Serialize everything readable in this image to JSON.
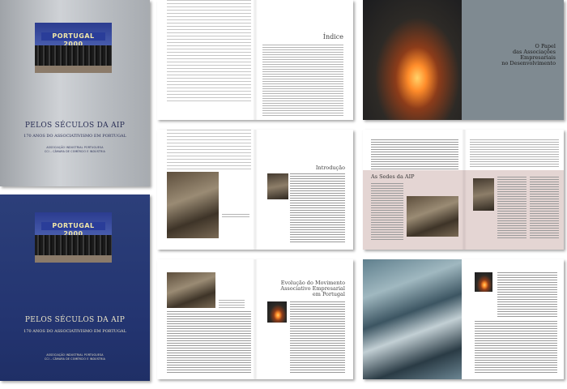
{
  "covers": [
    {
      "banner_text": "PORTUGAL 2000",
      "title": "PELOS SÉCULOS DA AIP",
      "subtitle": "170 ANOS DO ASSOCIATIVISMO EM PORTUGAL",
      "assoc_line1": "ASSOCIAÇÃO INDUSTRIAL PORTUGUESA",
      "assoc_line2": "CCI – CÂMARA DE COMÉRCIO E INDÚSTRIA",
      "background_color": "#b8bcc1",
      "text_color": "#2a2f55"
    },
    {
      "banner_text": "PORTUGAL 2000",
      "title": "PELOS SÉCULOS DA AIP",
      "subtitle": "170 ANOS DO ASSOCIATIVISMO EM PORTUGAL",
      "assoc_line1": "ASSOCIAÇÃO INDUSTRIAL PORTUGUESA",
      "assoc_line2": "CCI – CÂMARA DE COMÉRCIO E INDÚSTRIA",
      "background_color": "#233470",
      "text_color": "#e9e3c7"
    }
  ],
  "spreads": {
    "index_title": "Índice",
    "papel_title_l1": "O Papel",
    "papel_title_l2": "das Associações",
    "papel_title_l3": "Empresariais",
    "papel_title_l4": "no Desenvolvimento",
    "introducao_title": "Introdução",
    "sedes_title": "As Sedes da AIP",
    "evolucao_l1": "Evolução do Movimento",
    "evolucao_l2": "Associativo Empresarial",
    "evolucao_l3": "em Portugal"
  }
}
